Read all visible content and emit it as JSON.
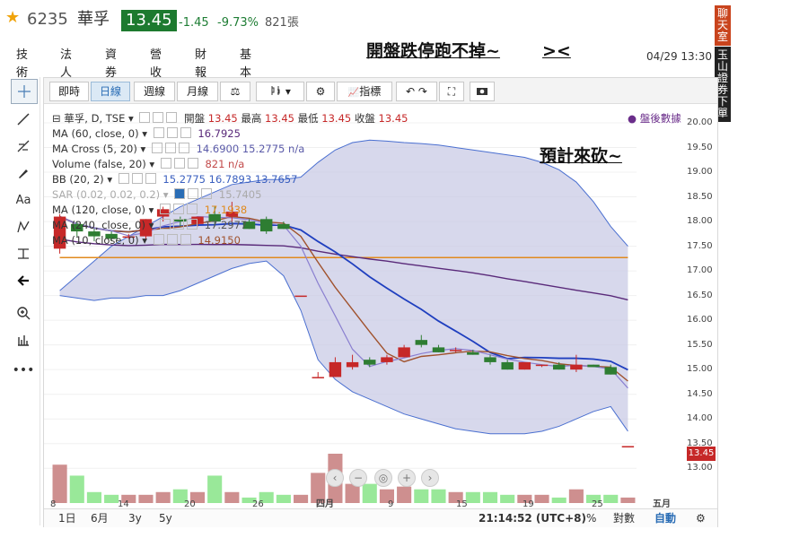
{
  "quote": {
    "code": "6235",
    "name": "華孚",
    "price": "13.45",
    "change": "-1.45",
    "change_pct": "-9.73%",
    "volume": "821張"
  },
  "tabs": [
    "技術",
    "法人",
    "資券",
    "營收",
    "財報",
    "基本"
  ],
  "note": "開盤跌停跑不掉~",
  "note2": "><",
  "datetime": "04/29 13:30",
  "side_buttons": {
    "chat": "聊天室",
    "order": "玉山證券下單"
  },
  "toolbar": {
    "buttons": [
      "即時",
      "日線",
      "週線",
      "月線",
      "指標"
    ],
    "selected": "日線"
  },
  "legend": {
    "main": {
      "label": "華孚, D, TSE",
      "open_label": "開盤",
      "open": "13.45",
      "high_label": "最高",
      "high": "13.45",
      "low_label": "最低",
      "low": "13.45",
      "close_label": "收盤",
      "close": "13.45"
    },
    "after_hours": "盤後數據",
    "ma60": {
      "label": "MA (60, close, 0)",
      "value": "16.7925"
    },
    "macross": {
      "label": "MA Cross (5, 20)",
      "value": "14.6900  15.2775  n/a"
    },
    "volume": {
      "label": "Volume (false, 20)",
      "value": "821  n/a"
    },
    "bb": {
      "label": "BB (20, 2)",
      "value": "15.2775  16.7893  13.7657"
    },
    "sar": {
      "label": "SAR (0.02, 0.02, 0.2)",
      "value": "15.7405"
    },
    "ma120": {
      "label": "MA (120, close, 0)",
      "value": "17.1938"
    },
    "ma240": {
      "label": "MA (240, close, 0)",
      "value": "17.2977"
    },
    "ma10": {
      "label": "MA (10, close, 0)",
      "value": "14.9150"
    }
  },
  "y_ticks": [
    "20.00",
    "19.50",
    "19.00",
    "18.50",
    "18.00",
    "17.50",
    "17.00",
    "16.50",
    "16.00",
    "15.50",
    "15.00",
    "14.50",
    "14.00",
    "13.50",
    "13.00"
  ],
  "price_tag": "13.45",
  "x_ticks": [
    "8",
    "14",
    "20",
    "26",
    "四月",
    "9",
    "15",
    "19",
    "25",
    "五月"
  ],
  "annotation": "預計來砍~",
  "bottom": {
    "ranges": [
      "1日",
      "6月",
      "3y",
      "5y"
    ],
    "time": "21:14:52 (UTC+8)",
    "pct": "%",
    "log": "對數",
    "auto": "自動"
  },
  "colors": {
    "up": "#c62828",
    "down": "#2e7d32",
    "band": "#c9cbe6",
    "ma_blue": "#1f3fbf",
    "ma_orange": "#e08a1e",
    "ma_purple": "#5a2a7a",
    "ma_brown": "#a0522d"
  },
  "chart_data": {
    "type": "candlestick",
    "ylim": [
      12.75,
      20.2
    ],
    "candles": [
      {
        "o": 17.45,
        "h": 18.15,
        "l": 17.35,
        "c": 18.1
      },
      {
        "o": 17.95,
        "h": 18.0,
        "l": 17.7,
        "c": 17.8
      },
      {
        "o": 17.8,
        "h": 17.85,
        "l": 17.6,
        "c": 17.7
      },
      {
        "o": 17.75,
        "h": 17.8,
        "l": 17.6,
        "c": 17.65
      },
      {
        "o": 17.7,
        "h": 17.75,
        "l": 17.65,
        "c": 17.7
      },
      {
        "o": 17.7,
        "h": 18.05,
        "l": 17.65,
        "c": 18.05
      },
      {
        "o": 18.1,
        "h": 18.3,
        "l": 18.0,
        "c": 18.25
      },
      {
        "o": 18.05,
        "h": 18.1,
        "l": 17.9,
        "c": 18.0
      },
      {
        "o": 17.95,
        "h": 18.1,
        "l": 17.9,
        "c": 18.1
      },
      {
        "o": 18.15,
        "h": 18.3,
        "l": 17.9,
        "c": 18.0
      },
      {
        "o": 18.1,
        "h": 18.4,
        "l": 18.0,
        "c": 18.2
      },
      {
        "o": 18.0,
        "h": 18.05,
        "l": 17.85,
        "c": 17.85
      },
      {
        "o": 18.05,
        "h": 18.1,
        "l": 17.75,
        "c": 17.8
      },
      {
        "o": 17.95,
        "h": 18.0,
        "l": 17.85,
        "c": 17.85
      },
      {
        "o": 16.5,
        "h": 16.5,
        "l": 16.5,
        "c": 16.5
      },
      {
        "o": 14.85,
        "h": 14.95,
        "l": 14.85,
        "c": 14.85
      },
      {
        "o": 14.85,
        "h": 15.25,
        "l": 14.85,
        "c": 15.15
      },
      {
        "o": 15.05,
        "h": 15.3,
        "l": 15.0,
        "c": 15.15
      },
      {
        "o": 15.2,
        "h": 15.25,
        "l": 15.05,
        "c": 15.1
      },
      {
        "o": 15.15,
        "h": 15.3,
        "l": 15.1,
        "c": 15.25
      },
      {
        "o": 15.25,
        "h": 15.5,
        "l": 15.25,
        "c": 15.45
      },
      {
        "o": 15.6,
        "h": 15.7,
        "l": 15.45,
        "c": 15.5
      },
      {
        "o": 15.45,
        "h": 15.5,
        "l": 15.35,
        "c": 15.35
      },
      {
        "o": 15.4,
        "h": 15.45,
        "l": 15.35,
        "c": 15.4
      },
      {
        "o": 15.35,
        "h": 15.4,
        "l": 15.3,
        "c": 15.3
      },
      {
        "o": 15.25,
        "h": 15.3,
        "l": 15.1,
        "c": 15.15
      },
      {
        "o": 15.15,
        "h": 15.2,
        "l": 15.0,
        "c": 15.0
      },
      {
        "o": 15.0,
        "h": 15.15,
        "l": 15.0,
        "c": 15.15
      },
      {
        "o": 15.1,
        "h": 15.1,
        "l": 15.05,
        "c": 15.1
      },
      {
        "o": 15.1,
        "h": 15.15,
        "l": 15.0,
        "c": 15.0
      },
      {
        "o": 15.0,
        "h": 15.3,
        "l": 14.95,
        "c": 15.1
      },
      {
        "o": 15.1,
        "h": 15.1,
        "l": 15.05,
        "c": 15.05
      },
      {
        "o": 15.05,
        "h": 15.1,
        "l": 14.9,
        "c": 14.9
      },
      {
        "o": 13.45,
        "h": 13.45,
        "l": 13.45,
        "c": 13.45
      }
    ],
    "volumes": [
      14,
      10,
      4,
      3,
      3,
      3,
      4,
      5,
      4,
      10,
      4,
      2,
      4,
      3,
      3,
      11,
      18,
      7,
      7,
      5,
      6,
      5,
      5,
      4,
      4,
      4,
      3,
      3,
      3,
      2,
      5,
      3,
      3,
      2
    ],
    "bb_upper": [
      16.6,
      16.9,
      17.2,
      17.5,
      17.7,
      17.9,
      18.1,
      18.3,
      18.45,
      18.6,
      18.75,
      18.8,
      18.85,
      18.85,
      18.9,
      19.2,
      19.45,
      19.6,
      19.65,
      19.63,
      19.6,
      19.58,
      19.55,
      19.5,
      19.45,
      19.4,
      19.35,
      19.3,
      19.2,
      19.05,
      18.8,
      18.4,
      17.9,
      17.5
    ],
    "bb_lower": [
      16.5,
      16.45,
      16.4,
      16.45,
      16.45,
      16.5,
      16.5,
      16.6,
      16.75,
      16.9,
      17.05,
      17.15,
      17.2,
      16.9,
      16.2,
      15.2,
      14.8,
      14.55,
      14.4,
      14.25,
      14.1,
      14.0,
      13.9,
      13.8,
      13.75,
      13.7,
      13.7,
      13.7,
      13.75,
      13.85,
      14.0,
      14.15,
      14.25,
      13.75
    ]
  }
}
